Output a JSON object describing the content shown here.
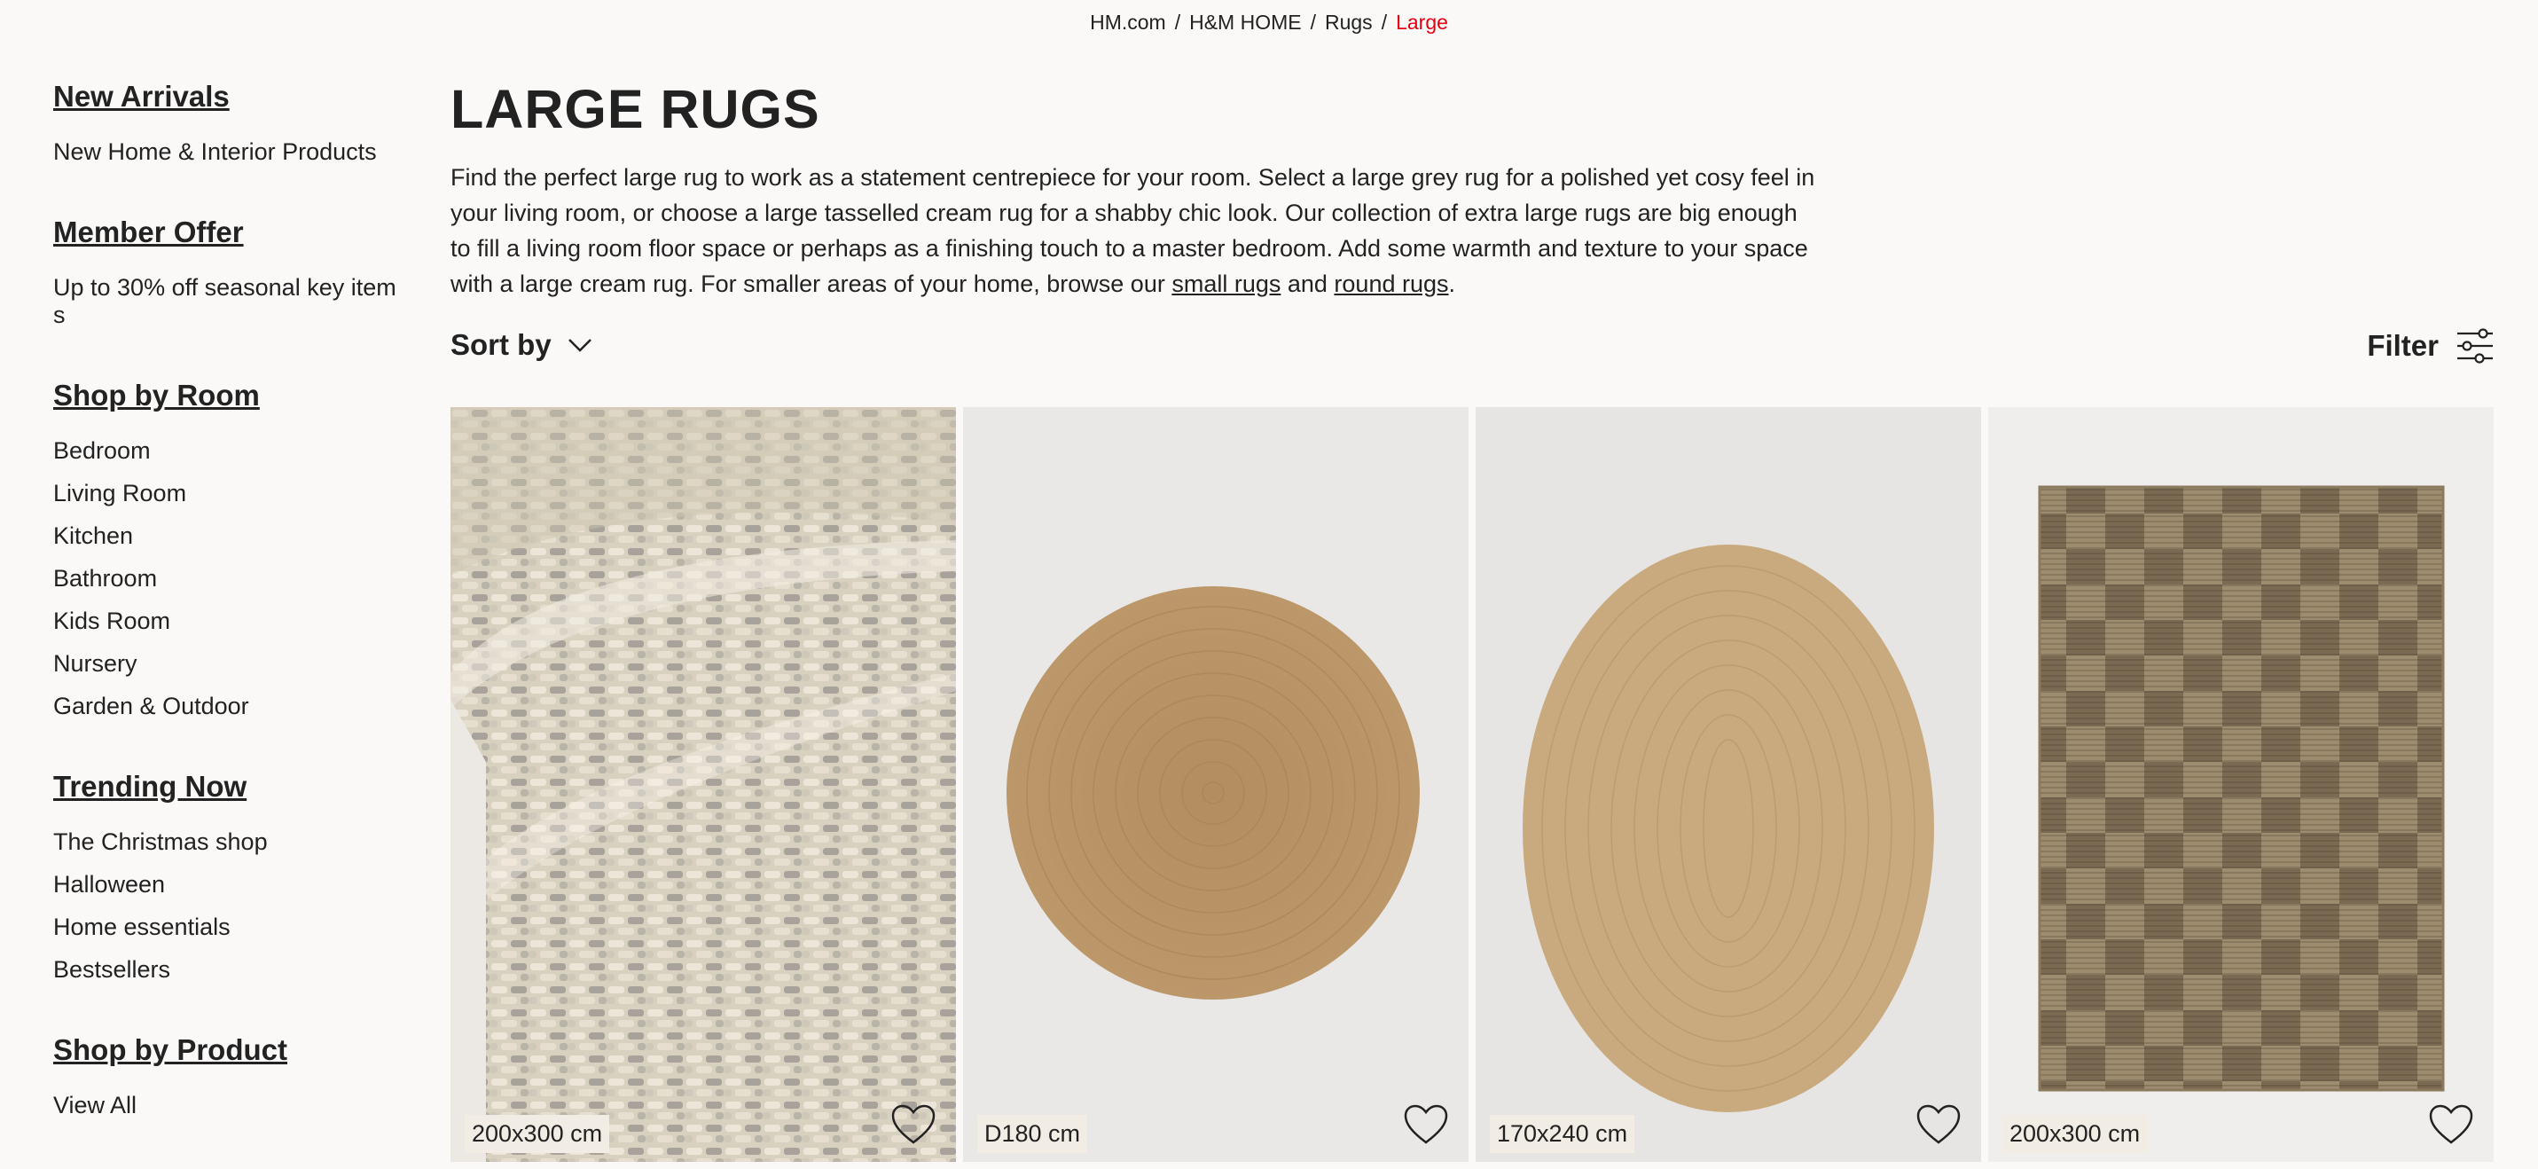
{
  "breadcrumb": {
    "items": [
      "HM.com",
      "H&M HOME",
      "Rugs"
    ],
    "current": "Large",
    "separator": "/"
  },
  "sidebar": {
    "groups": [
      {
        "title": "New Arrivals",
        "links": [
          "New Home & Interior Products"
        ]
      },
      {
        "title": "Member Offer",
        "links": [
          "Up to 30% off seasonal key item s"
        ]
      },
      {
        "title": "Shop by Room",
        "links": [
          "Bedroom",
          "Living Room",
          "Kitchen",
          "Bathroom",
          "Kids Room",
          "Nursery",
          "Garden & Outdoor"
        ]
      },
      {
        "title": "Trending Now",
        "links": [
          "The Christmas shop",
          "Halloween",
          "Home essentials",
          "Bestsellers"
        ]
      },
      {
        "title": "Shop by Product",
        "links": [
          "View All"
        ]
      }
    ]
  },
  "main": {
    "title": "LARGE RUGS",
    "description_before": "Find the perfect large rug to work as a statement centrepiece for your room. Select a large grey rug for a polished yet cosy feel in your living room, or choose a large tasselled cream rug for a shabby chic look. Our collection of extra large rugs are big enough to fill a living room floor space or perhaps as a finishing touch to a master bedroom. Add some warmth and texture to your space with a large cream rug. For smaller areas of your home, browse our ",
    "link_small": "small rugs",
    "description_mid": " and ",
    "link_round": "round rugs",
    "description_end": "."
  },
  "controls": {
    "sort_label": "Sort by",
    "filter_label": "Filter"
  },
  "products": [
    {
      "size": "200x300 cm",
      "image": "woven-cream-grey-rug"
    },
    {
      "size": "D180 cm",
      "image": "round-jute-rug"
    },
    {
      "size": "170x240 cm",
      "image": "oval-jute-rug"
    },
    {
      "size": "200x300 cm",
      "image": "checked-jute-rug"
    }
  ],
  "colors": {
    "accent": "#e50010",
    "text": "#222222",
    "background": "#faf9f8",
    "badge": "#f1ece4"
  }
}
